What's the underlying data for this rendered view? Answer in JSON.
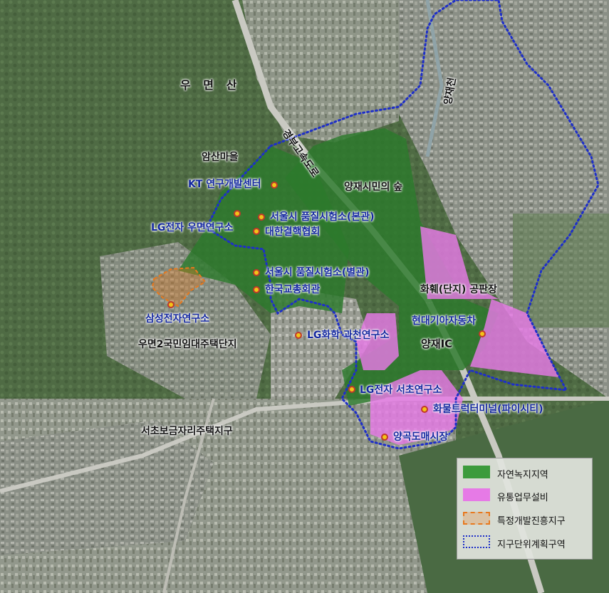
{
  "places": {
    "mountain": "우 면 산",
    "amsan": "암산마을",
    "yangjae_forest": "양재시민의 숲",
    "yangjae_ic": "양재IC",
    "umyeon_apt": "우면2국민임대주택단지",
    "seocho_district": "서초보금자리주택지구",
    "highway": "경부고속도로",
    "stream": "양재천"
  },
  "facilities": {
    "kt": "KT 연구개발센터",
    "lg_umyeon": "LG전자 우면연구소",
    "seoul_quality_main": "서울시 품질시험소(본관)",
    "korea_consumer": "대한결핵협회",
    "seoul_quality_annex": "서울시 품질시험소(별관)",
    "teachers": "한국교총회관",
    "samsung": "삼성전자연구소",
    "lg_chem": "LG화학 과천연구소",
    "hwahwe": "화훼(단지) 공판장",
    "hyundai_kia": "현대기아자동차",
    "lg_seocho": "LG전자 서초연구소",
    "truck_terminal": "화물트럭터미널(파이시티)",
    "yanggok_market": "양곡도매시장"
  },
  "legend": {
    "items": [
      {
        "label": "자연녹지지역",
        "color": "#3c9b3c"
      },
      {
        "label": "유통업무설비",
        "color": "#e67ae6"
      },
      {
        "label": "특정개발진흥지구",
        "color": "#e8791e"
      },
      {
        "label": "지구단위계획구역",
        "color": "#1e2fc8"
      }
    ]
  }
}
